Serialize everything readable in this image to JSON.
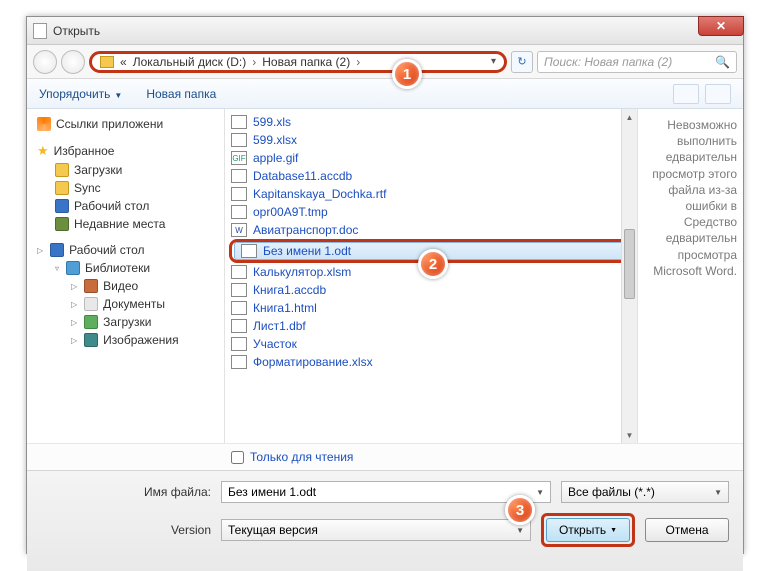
{
  "title": "Открыть",
  "breadcrumb": {
    "chev": "«",
    "seg1": "Локальный диск (D:)",
    "seg2": "Новая папка (2)",
    "sep": "›"
  },
  "search": {
    "placeholder": "Поиск: Новая папка (2)"
  },
  "toolbar": {
    "organize": "Упорядочить",
    "new_folder": "Новая папка"
  },
  "sidebar": {
    "app_links": "Ссылки приложени",
    "favorites": "Избранное",
    "downloads": "Загрузки",
    "sync": "Sync",
    "desktop": "Рабочий стол",
    "recent": "Недавние места",
    "desktop2": "Рабочий стол",
    "libraries": "Библиотеки",
    "video": "Видео",
    "documents": "Документы",
    "downloads2": "Загрузки",
    "images": "Изображения"
  },
  "files": {
    "f0": "599.xls",
    "f1": "599.xlsx",
    "f2": "apple.gif",
    "f3": "Database11.accdb",
    "f4": "Kapitanskaya_Dochka.rtf",
    "f5": "opr00A9T.tmp",
    "f6": "Авиатранспорт.doc",
    "f7": "Без имени 1.odt",
    "f8": "Калькулятор.xlsm",
    "f9": "Книга1.accdb",
    "f10": "Книга1.html",
    "f11": "Лист1.dbf",
    "f12": "Участок",
    "f13": "Форматирование.xlsx"
  },
  "preview": {
    "text": "Невозможно выполнить едварительн просмотр этого файла из-за ошибки в Средство едварительн просмотра Microsoft Word."
  },
  "readonly": "Только для чтения",
  "footer": {
    "filename_label": "Имя файла:",
    "filename_value": "Без имени 1.odt",
    "filter": "Все файлы (*.*)",
    "version_label": "Version",
    "version_value": "Текущая версия",
    "open": "Открыть",
    "cancel": "Отмена"
  },
  "callouts": {
    "c1": "1",
    "c2": "2",
    "c3": "3"
  }
}
